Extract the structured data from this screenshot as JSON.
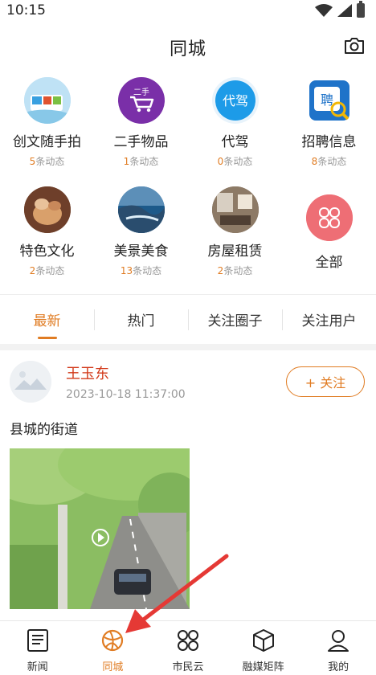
{
  "status_bar": {
    "time": "10:15"
  },
  "header": {
    "title": "同城"
  },
  "categories": [
    {
      "label": "创文随手拍",
      "count": "5",
      "suffix": "条动态"
    },
    {
      "label": "二手物品",
      "count": "1",
      "suffix": "条动态",
      "icon_text": "二手"
    },
    {
      "label": "代驾",
      "count": "0",
      "suffix": "条动态",
      "icon_text": "代驾"
    },
    {
      "label": "招聘信息",
      "count": "8",
      "suffix": "条动态",
      "icon_text": "聘"
    },
    {
      "label": "特色文化",
      "count": "2",
      "suffix": "条动态"
    },
    {
      "label": "美景美食",
      "count": "13",
      "suffix": "条动态"
    },
    {
      "label": "房屋租赁",
      "count": "2",
      "suffix": "条动态"
    },
    {
      "label": "全部"
    }
  ],
  "tabs": [
    {
      "label": "最新",
      "active": true
    },
    {
      "label": "热门"
    },
    {
      "label": "关注圈子"
    },
    {
      "label": "关注用户"
    }
  ],
  "post": {
    "user_name": "王玉东",
    "time": "2023-10-18 11:37:00",
    "follow_label": "+ 关注",
    "text": "县城的街道"
  },
  "bottom_nav": [
    {
      "label": "新闻"
    },
    {
      "label": "同城",
      "active": true
    },
    {
      "label": "市民云"
    },
    {
      "label": "融媒矩阵"
    },
    {
      "label": "我的"
    }
  ],
  "colors": {
    "accent": "#e07c23",
    "username": "#d23a1a"
  }
}
